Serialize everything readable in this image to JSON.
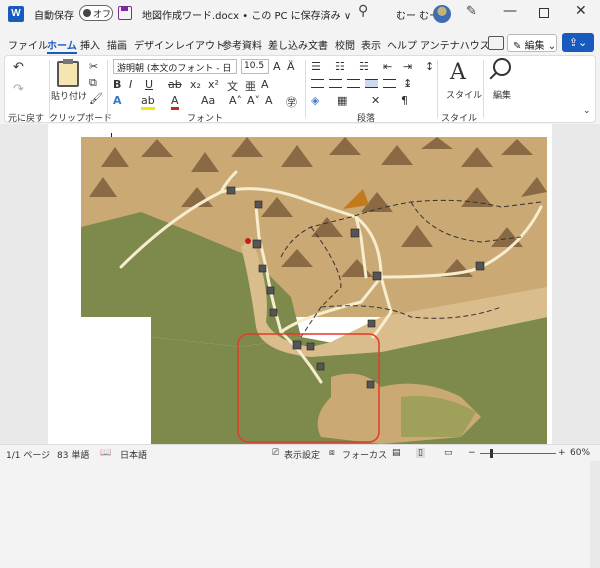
{
  "titlebar": {
    "app_letter": "W",
    "autosave_label": "自動保存",
    "autosave_state": "オフ",
    "document_title": "地図作成ワード.docx • この PC に保存済み ∨",
    "user_name": "むー むー"
  },
  "tabs": [
    {
      "label": "ファイル",
      "active": false
    },
    {
      "label": "ホーム",
      "active": true
    },
    {
      "label": "挿入",
      "active": false
    },
    {
      "label": "描画",
      "active": false
    },
    {
      "label": "デザイン",
      "active": false
    },
    {
      "label": "レイアウト",
      "active": false
    },
    {
      "label": "参考資料",
      "active": false
    },
    {
      "label": "差し込み文書",
      "active": false
    },
    {
      "label": "校閲",
      "active": false
    },
    {
      "label": "表示",
      "active": false
    },
    {
      "label": "ヘルプ",
      "active": false
    },
    {
      "label": "アンテナハウス",
      "active": false
    }
  ],
  "header_right": {
    "edit_label": "編集"
  },
  "ribbon": {
    "undo_group_label": "元に戻す",
    "paste_label": "貼り付け",
    "clipboard_group_label": "クリップボード",
    "font_name": "游明朝 (本文のフォント - 日",
    "font_size": "10.5",
    "font_group_label": "フォント",
    "paragraph_group_label": "段落",
    "style_label": "スタイル",
    "style_group_label": "スタイル",
    "editing_label": "編集"
  },
  "statusbar": {
    "page_info": "1/1 ページ",
    "word_count": "83 単語",
    "language": "日本語",
    "display_settings": "表示設定",
    "focus": "フォーカス",
    "zoom_level": "60%"
  },
  "colors": {
    "accent": "#185abd",
    "map_sand": "#cba974",
    "map_forest": "#7d8a4c",
    "map_road": "#f6ecce",
    "highlight_box": "#e53a2a"
  }
}
